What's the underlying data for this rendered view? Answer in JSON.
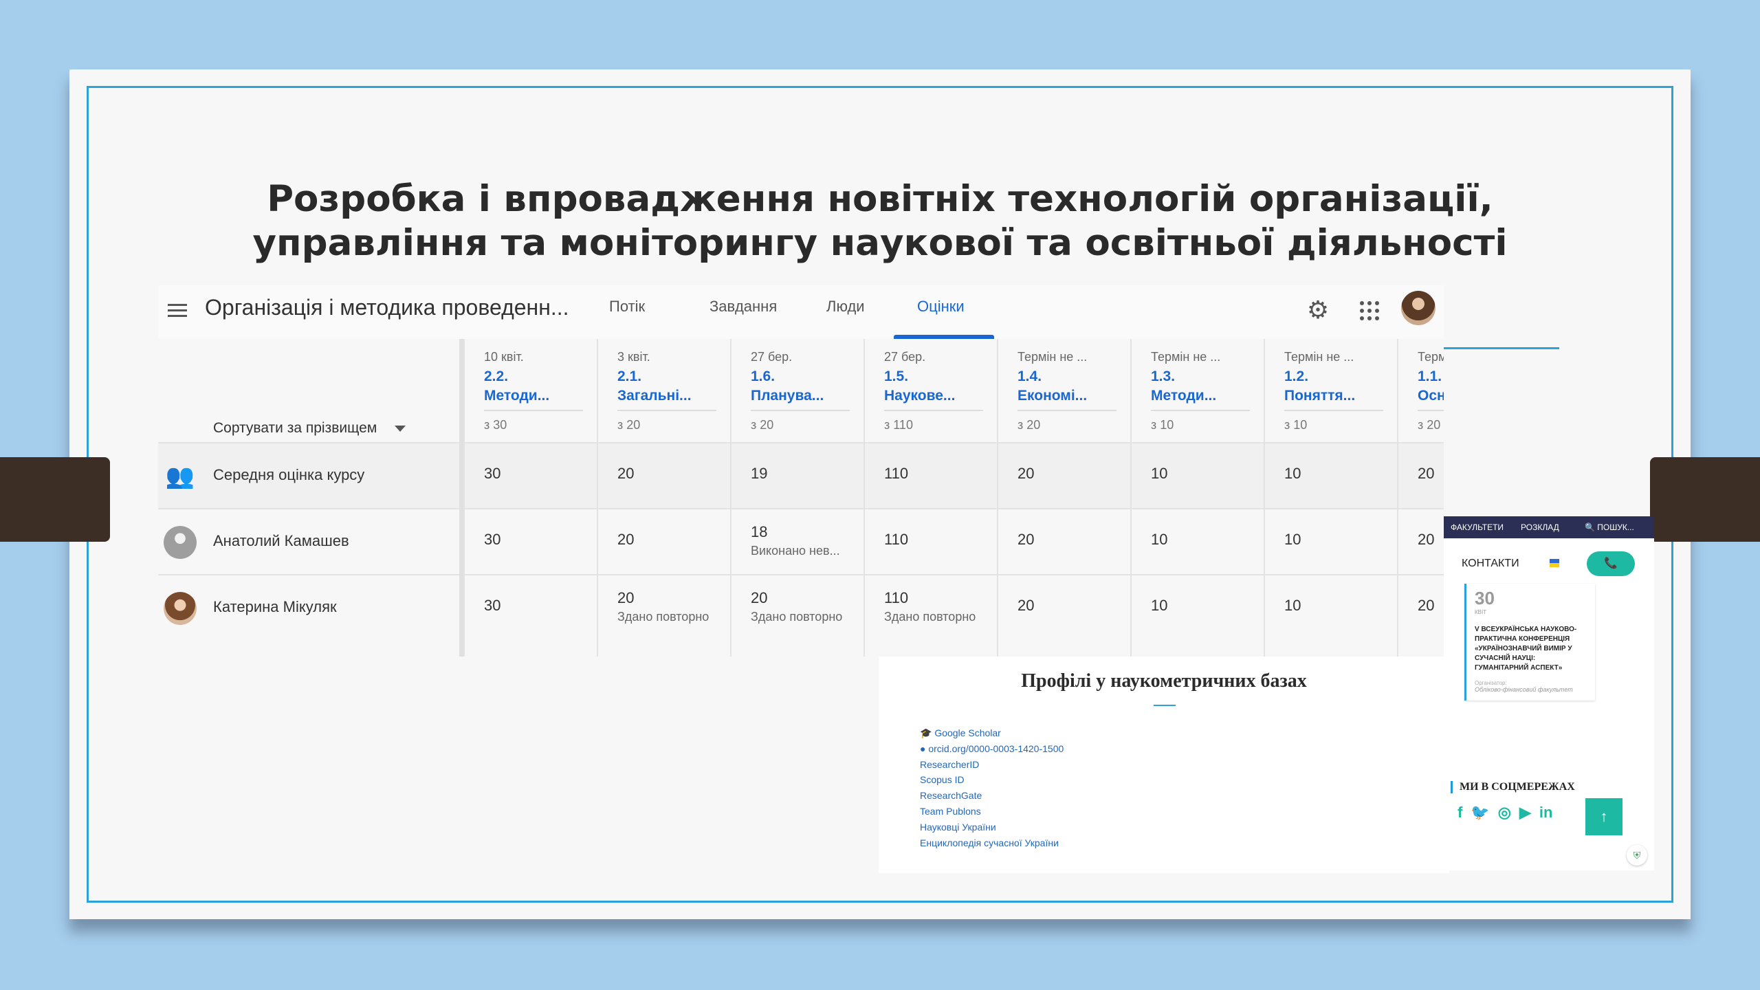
{
  "slide": {
    "title_line1": "Розробка і впровадження новітніх технологій організації,",
    "title_line2": "управління та моніторингу наукової та освітньої діяльності"
  },
  "classroom": {
    "course_title": "Організація і методика проведенн...",
    "tabs": [
      "Потік",
      "Завдання",
      "Люди",
      "Оцінки"
    ],
    "active_tab": "Оцінки",
    "sort_label": "Сортувати за прізвищем",
    "assignments": [
      {
        "date": "10 квіт.",
        "num": "2.2.",
        "title": "Методи...",
        "max": "з 30"
      },
      {
        "date": "3 квіт.",
        "num": "2.1.",
        "title": "Загальні...",
        "max": "з 20"
      },
      {
        "date": "27 бер.",
        "num": "1.6.",
        "title": "Планува...",
        "max": "з 20"
      },
      {
        "date": "27 бер.",
        "num": "1.5.",
        "title": "Наукове...",
        "max": "з 110"
      },
      {
        "date": "Термін не ...",
        "num": "1.4.",
        "title": "Економі...",
        "max": "з 20"
      },
      {
        "date": "Термін не ...",
        "num": "1.3.",
        "title": "Методи...",
        "max": "з 10"
      },
      {
        "date": "Термін не ...",
        "num": "1.2.",
        "title": "Поняття...",
        "max": "з 10"
      },
      {
        "date": "Термі",
        "num": "1.1.",
        "title": "Осно",
        "max": "з 20"
      }
    ],
    "rows": [
      {
        "name": "Середня оцінка курсу",
        "grades": [
          {
            "v": "30"
          },
          {
            "v": "20"
          },
          {
            "v": "19"
          },
          {
            "v": "110"
          },
          {
            "v": "20"
          },
          {
            "v": "10"
          },
          {
            "v": "10"
          },
          {
            "v": "20"
          }
        ]
      },
      {
        "name": "Анатолий Камашев",
        "grades": [
          {
            "v": "30"
          },
          {
            "v": "20"
          },
          {
            "v": "18",
            "s": "Виконано нев..."
          },
          {
            "v": "110"
          },
          {
            "v": "20"
          },
          {
            "v": "10"
          },
          {
            "v": "10"
          },
          {
            "v": "20"
          }
        ]
      },
      {
        "name": "Катерина Мікуляк",
        "grades": [
          {
            "v": "30"
          },
          {
            "v": "20",
            "s": "Здано повторно"
          },
          {
            "v": "20",
            "s": "Здано повторно"
          },
          {
            "v": "110",
            "s": "Здано повторно"
          },
          {
            "v": "20"
          },
          {
            "v": "10"
          },
          {
            "v": "10"
          },
          {
            "v": "20"
          }
        ]
      }
    ]
  },
  "site": {
    "title": "Профілі у наукометричних базах",
    "links": [
      "🎓 Google Scholar",
      "● orcid.org/0000-0003-1420-1500",
      "ResearcherID",
      "Scopus ID",
      "ResearchGate",
      "Team Publons",
      "Науковці України",
      "Енциклопедія сучасної України"
    ]
  },
  "side": {
    "nav": [
      "ФАКУЛЬТЕТИ",
      "РОЗКЛАД",
      "ПОШУК..."
    ],
    "contacts": "КОНТАКТИ",
    "event_day": "30",
    "event_month": "КВІТ",
    "event_title": "V ВСЕУКРАЇНСЬКА НАУКОВО-ПРАКТИЧНА КОНФЕРЕНЦІЯ «УКРАЇНОЗНАВЧИЙ ВИМІР У СУЧАСНІЙ НАУЦІ: ГУМАНІТАРНИЙ АСПЕКТ»",
    "event_org": "Організатор:",
    "event_fac": "Обліково-фінансовий факультет",
    "social_title": "МИ В СОЦМЕРЕЖАХ",
    "social": [
      "f",
      "🐦",
      "◎",
      "▶",
      "in"
    ],
    "to_top": "↑"
  },
  "colors": {
    "accent": "#1967d2",
    "frame": "#2ba3d8",
    "teal": "#1eb9a2",
    "background": "#a5cdec"
  }
}
